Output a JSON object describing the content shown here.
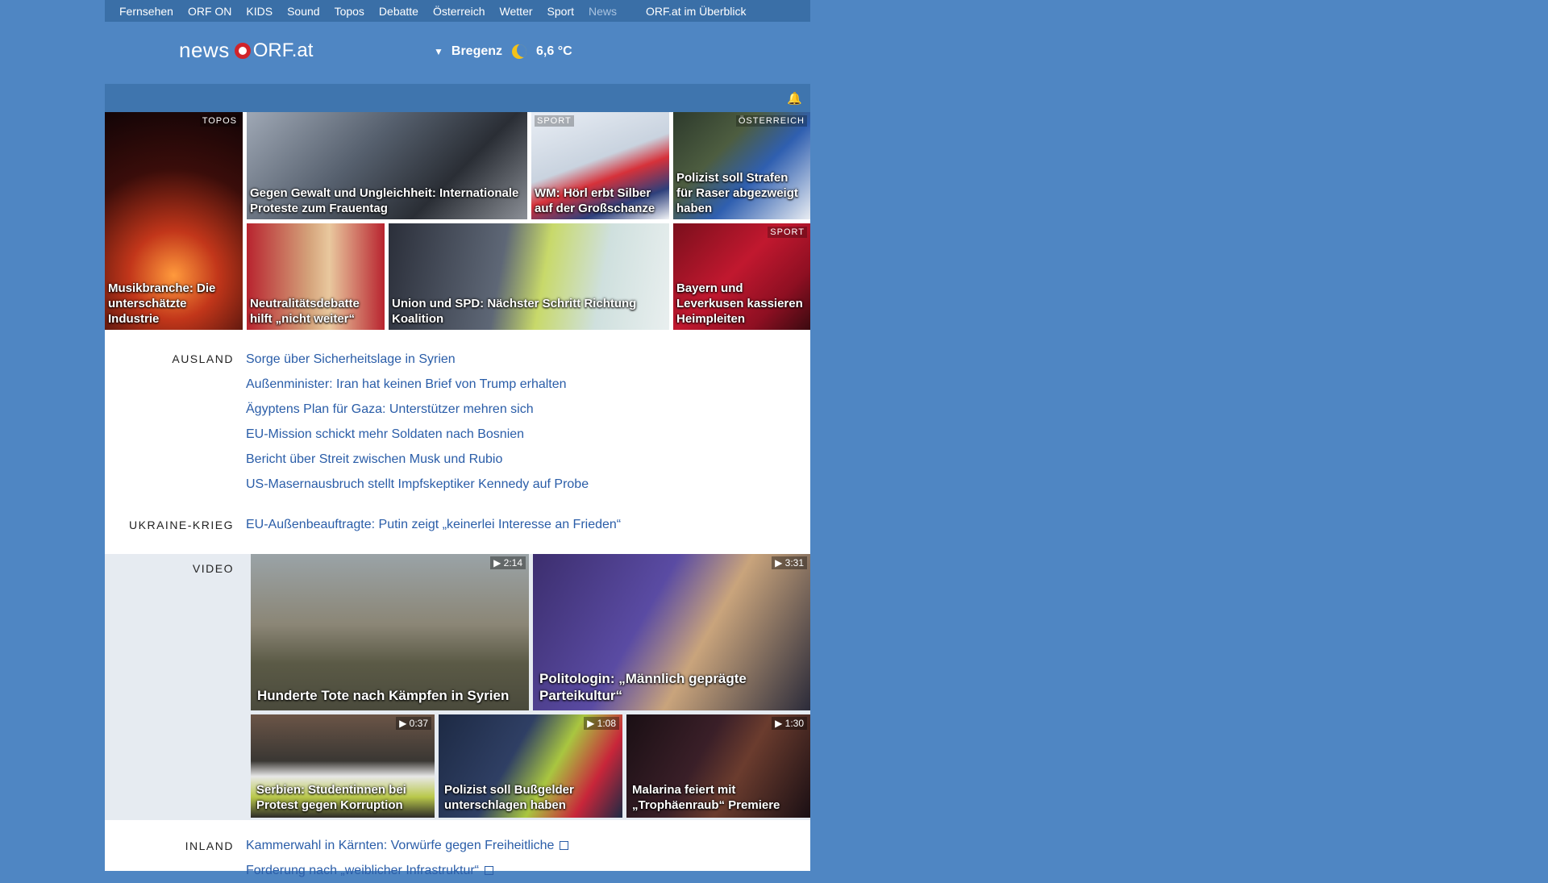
{
  "nav": {
    "items": [
      "Fernsehen",
      "ORF ON",
      "KIDS",
      "Sound",
      "Topos",
      "Debatte",
      "Österreich",
      "Wetter",
      "Sport",
      "News"
    ],
    "active": "News",
    "overview": "ORF.at im Überblick"
  },
  "logo": {
    "news": "news",
    "orf": "ORF.at"
  },
  "weather": {
    "city": "Bregenz",
    "temp": "6,6 °C",
    "icon": "moon-icon"
  },
  "top_tiles": [
    {
      "title": "Musikbranche: Die unterschätzte Industrie",
      "tag": "TOPOS"
    },
    {
      "title": "Gegen Gewalt und Ungleichheit: Internationale Proteste zum Frauentag",
      "tag": ""
    },
    {
      "title": "WM: Hörl erbt Silber auf der Großschanze",
      "tag": "SPORT"
    },
    {
      "title": "Polizist soll Strafen für Raser abgezweigt haben",
      "tag": "ÖSTERREICH"
    },
    {
      "title": "Neutralitätsdebatte hilft „nicht weiter“",
      "tag": ""
    },
    {
      "title": "Union und SPD: Nächster Schritt Richtung Koalition",
      "tag": ""
    },
    {
      "title": "Bayern und Leverkusen kassieren Heimpleiten",
      "tag": "SPORT"
    }
  ],
  "ausland": {
    "label": "AUSLAND",
    "links": [
      "Sorge über Sicherheitslage in Syrien",
      "Außenminister: Iran hat keinen Brief von Trump erhalten",
      "Ägyptens Plan für Gaza: Unterstützer mehren sich",
      "EU-Mission schickt mehr Soldaten nach Bosnien",
      "Bericht über Streit zwischen Musk und Rubio",
      "US-Masernausbruch stellt Impfskeptiker Kennedy auf Probe"
    ]
  },
  "ukraine": {
    "label": "UKRAINE-KRIEG",
    "links": [
      "EU-Außenbeauftragte: Putin zeigt „keinerlei Interesse an Frieden“"
    ]
  },
  "video": {
    "label": "VIDEO",
    "items": [
      {
        "title": "Hunderte Tote nach Kämpfen in Syrien",
        "duration": "2:14"
      },
      {
        "title": "Politologin: „Männlich geprägte Parteikultur“",
        "duration": "3:31"
      },
      {
        "title": "Serbien: Studentinnen bei Protest gegen Korruption",
        "duration": "0:37"
      },
      {
        "title": "Polizist soll Bußgelder unterschlagen haben",
        "duration": "1:08"
      },
      {
        "title": "Malarina feiert mit „Trophäenraub“ Premiere",
        "duration": "1:30"
      }
    ]
  },
  "inland": {
    "label": "INLAND",
    "links": [
      "Kammerwahl in Kärnten: Vorwürfe gegen Freiheitliche",
      "Forderung nach „weiblicher Infrastruktur“"
    ]
  },
  "colors": {
    "page_bg": "#4f86c3",
    "nav_bg": "#3a6fa7",
    "link": "#2a5da8",
    "logo_red": "#d1232a"
  }
}
